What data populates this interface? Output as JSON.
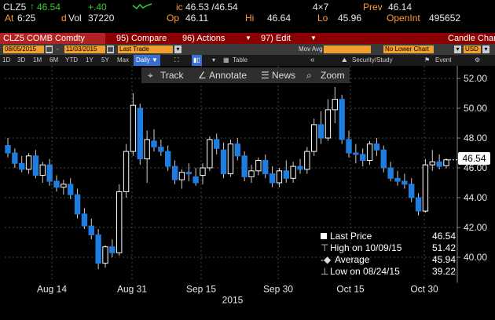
{
  "quote": {
    "ticker": "CLZ5",
    "arrow": "↑",
    "last": "46.54",
    "change": "+.40",
    "time_label": "At",
    "time": "6:25",
    "dvol_label": "d",
    "vol_label": "Vol",
    "vol": "37220",
    "ic_label": "ic",
    "bid_ask": "46.53 /46.54",
    "size": "4×7",
    "prev_label": "Prev",
    "prev": "46.14",
    "open_label": "Op",
    "open": "46.11",
    "high_label": "Hi",
    "high": "46.64",
    "low_label": "Lo",
    "low": "45.96",
    "oi_label": "OpenInt",
    "oi": "495652"
  },
  "menu": {
    "security": "CLZ5 COMB Comdty",
    "compare": "95) Compare",
    "actions": "96) Actions",
    "edit": "97) Edit",
    "chart_name": "Candle Chart"
  },
  "settings": {
    "start_date": "08/05/2015",
    "end_date": "11/03/2015",
    "dash": "-",
    "field": "Last Trade",
    "mov_avg": "Mov Avg",
    "lower": "No Lower Chart",
    "currency": "USD"
  },
  "periods": [
    "1D",
    "3D",
    "1M",
    "6M",
    "YTD",
    "1Y",
    "5Y",
    "Max"
  ],
  "frequency": "Daily ▼",
  "view_table": "Table",
  "security_study": "Security/Study",
  "event": "Event",
  "toolbar": {
    "track": "Track",
    "annotate": "Annotate",
    "news": "News",
    "zoom": "Zoom"
  },
  "colors": {
    "up": "#ffffff",
    "down": "#1e7de0",
    "accent": "#ff9933",
    "header_red": "#8b0000"
  },
  "legend": [
    {
      "label": "Last Price",
      "value": "46.54"
    },
    {
      "label": "High on 10/09/15",
      "value": "51.42"
    },
    {
      "label": "Average",
      "value": "45.94"
    },
    {
      "label": "Low on 08/24/15",
      "value": "39.22"
    }
  ],
  "badge": "46.54",
  "chart_data": {
    "type": "candlestick",
    "ylim": [
      38.5,
      53.0
    ],
    "yticks": [
      "52.00",
      "50.00",
      "48.00",
      "46.00",
      "44.00",
      "42.00",
      "40.00"
    ],
    "xticks": [
      "Aug 14",
      "Aug 31",
      "Sep 15",
      "Sep 30",
      "Oct 15",
      "Oct 30"
    ],
    "year_label": "2015",
    "candles": [
      {
        "o": 47.5,
        "h": 48.0,
        "l": 46.7,
        "c": 47.0
      },
      {
        "o": 47.0,
        "h": 47.3,
        "l": 46.0,
        "c": 46.3
      },
      {
        "o": 46.3,
        "h": 46.8,
        "l": 45.7,
        "c": 45.9
      },
      {
        "o": 45.9,
        "h": 47.0,
        "l": 45.6,
        "c": 46.8
      },
      {
        "o": 46.8,
        "h": 47.2,
        "l": 45.3,
        "c": 45.5
      },
      {
        "o": 45.5,
        "h": 46.4,
        "l": 45.0,
        "c": 46.2
      },
      {
        "o": 46.2,
        "h": 46.6,
        "l": 44.8,
        "c": 45.1
      },
      {
        "o": 45.1,
        "h": 45.5,
        "l": 44.4,
        "c": 44.7
      },
      {
        "o": 44.7,
        "h": 45.2,
        "l": 44.2,
        "c": 44.9
      },
      {
        "o": 44.9,
        "h": 45.3,
        "l": 43.9,
        "c": 44.2
      },
      {
        "o": 44.2,
        "h": 44.6,
        "l": 42.6,
        "c": 42.9
      },
      {
        "o": 42.9,
        "h": 43.3,
        "l": 41.9,
        "c": 42.1
      },
      {
        "o": 42.1,
        "h": 42.6,
        "l": 41.2,
        "c": 41.5
      },
      {
        "o": 41.5,
        "h": 41.9,
        "l": 39.2,
        "c": 39.6
      },
      {
        "o": 39.6,
        "h": 40.8,
        "l": 39.3,
        "c": 40.7
      },
      {
        "o": 40.7,
        "h": 41.2,
        "l": 40.0,
        "c": 40.3
      },
      {
        "o": 40.3,
        "h": 44.9,
        "l": 40.1,
        "c": 44.4
      },
      {
        "o": 44.4,
        "h": 47.6,
        "l": 44.0,
        "c": 47.1
      },
      {
        "o": 47.1,
        "h": 51.0,
        "l": 46.8,
        "c": 50.2
      },
      {
        "o": 50.0,
        "h": 50.3,
        "l": 46.2,
        "c": 46.6
      },
      {
        "o": 46.6,
        "h": 48.5,
        "l": 45.0,
        "c": 47.9
      },
      {
        "o": 47.8,
        "h": 48.6,
        "l": 47.1,
        "c": 47.4
      },
      {
        "o": 47.4,
        "h": 47.9,
        "l": 46.8,
        "c": 47.1
      },
      {
        "o": 47.1,
        "h": 47.5,
        "l": 45.8,
        "c": 46.1
      },
      {
        "o": 46.1,
        "h": 46.5,
        "l": 44.9,
        "c": 45.2
      },
      {
        "o": 45.2,
        "h": 45.9,
        "l": 44.6,
        "c": 45.7
      },
      {
        "o": 45.7,
        "h": 46.3,
        "l": 45.1,
        "c": 45.6
      },
      {
        "o": 45.4,
        "h": 46.0,
        "l": 44.8,
        "c": 45.0
      },
      {
        "o": 45.5,
        "h": 46.3,
        "l": 44.9,
        "c": 46.0
      },
      {
        "o": 46.0,
        "h": 48.1,
        "l": 45.8,
        "c": 47.9
      },
      {
        "o": 47.9,
        "h": 48.3,
        "l": 46.9,
        "c": 47.3
      },
      {
        "o": 47.2,
        "h": 47.7,
        "l": 45.3,
        "c": 45.6
      },
      {
        "o": 45.6,
        "h": 47.9,
        "l": 45.4,
        "c": 47.6
      },
      {
        "o": 47.6,
        "h": 48.0,
        "l": 46.5,
        "c": 46.8
      },
      {
        "o": 46.8,
        "h": 47.1,
        "l": 45.1,
        "c": 45.4
      },
      {
        "o": 45.4,
        "h": 46.2,
        "l": 45.0,
        "c": 45.8
      },
      {
        "o": 45.8,
        "h": 46.7,
        "l": 45.5,
        "c": 46.5
      },
      {
        "o": 46.5,
        "h": 46.9,
        "l": 45.3,
        "c": 45.6
      },
      {
        "o": 45.6,
        "h": 46.1,
        "l": 44.7,
        "c": 45.0
      },
      {
        "o": 45.0,
        "h": 46.0,
        "l": 44.7,
        "c": 45.8
      },
      {
        "o": 45.8,
        "h": 46.5,
        "l": 45.0,
        "c": 45.3
      },
      {
        "o": 45.3,
        "h": 46.4,
        "l": 45.0,
        "c": 46.1
      },
      {
        "o": 46.1,
        "h": 46.6,
        "l": 45.6,
        "c": 45.9
      },
      {
        "o": 45.9,
        "h": 47.4,
        "l": 45.6,
        "c": 47.1
      },
      {
        "o": 47.1,
        "h": 49.3,
        "l": 46.8,
        "c": 48.9
      },
      {
        "o": 48.9,
        "h": 49.8,
        "l": 47.6,
        "c": 48.0
      },
      {
        "o": 48.0,
        "h": 50.6,
        "l": 47.8,
        "c": 49.9
      },
      {
        "o": 49.9,
        "h": 51.42,
        "l": 49.0,
        "c": 50.6
      },
      {
        "o": 50.6,
        "h": 50.9,
        "l": 47.6,
        "c": 47.9
      },
      {
        "o": 47.9,
        "h": 48.5,
        "l": 46.7,
        "c": 47.0
      },
      {
        "o": 47.0,
        "h": 47.6,
        "l": 46.3,
        "c": 46.9
      },
      {
        "o": 46.9,
        "h": 47.3,
        "l": 46.1,
        "c": 46.5
      },
      {
        "o": 46.5,
        "h": 47.8,
        "l": 46.2,
        "c": 47.6
      },
      {
        "o": 47.6,
        "h": 48.0,
        "l": 46.8,
        "c": 47.2
      },
      {
        "o": 47.2,
        "h": 47.5,
        "l": 45.7,
        "c": 46.0
      },
      {
        "o": 46.0,
        "h": 46.4,
        "l": 45.1,
        "c": 45.3
      },
      {
        "o": 45.3,
        "h": 45.8,
        "l": 44.8,
        "c": 45.1
      },
      {
        "o": 45.1,
        "h": 45.6,
        "l": 44.6,
        "c": 44.9
      },
      {
        "o": 44.9,
        "h": 45.3,
        "l": 43.7,
        "c": 44.0
      },
      {
        "o": 44.0,
        "h": 44.3,
        "l": 42.8,
        "c": 43.1
      },
      {
        "o": 43.1,
        "h": 46.6,
        "l": 43.0,
        "c": 46.2
      },
      {
        "o": 46.2,
        "h": 47.2,
        "l": 45.8,
        "c": 46.4
      },
      {
        "o": 46.4,
        "h": 46.9,
        "l": 45.9,
        "c": 46.1
      },
      {
        "o": 46.14,
        "h": 46.64,
        "l": 45.96,
        "c": 46.54
      }
    ]
  }
}
